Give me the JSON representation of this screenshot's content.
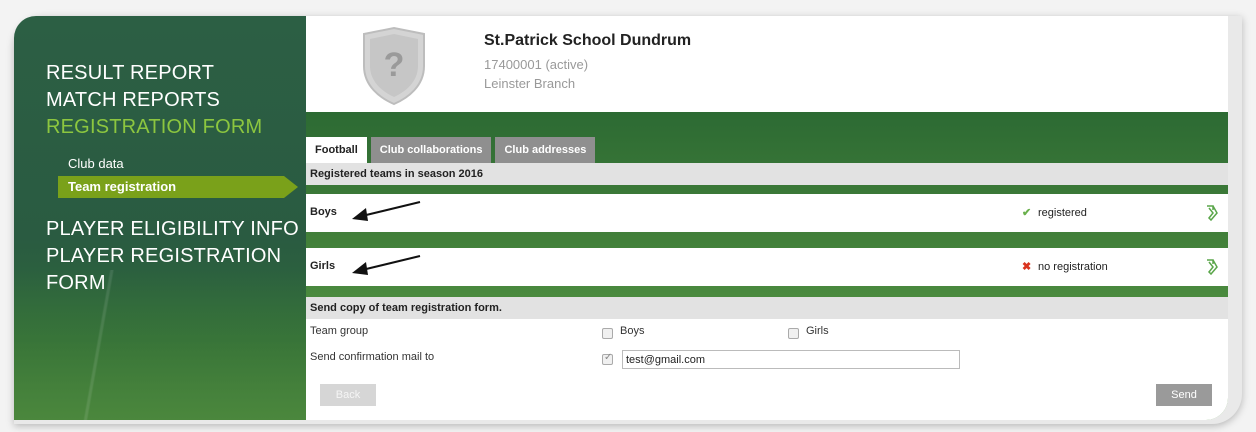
{
  "sidebar": {
    "nav_top": [
      "RESULT REPORT",
      "MATCH REPORTS",
      "REGISTRATION FORM"
    ],
    "sub_items": [
      "Club data",
      "Team registration"
    ],
    "nav_bottom": [
      "PLAYER ELIGIBILITY INFO",
      "PLAYER REGISTRATION FORM"
    ]
  },
  "club": {
    "name": "St.Patrick School Dundrum",
    "id_status": "17400001 (active)",
    "branch": "Leinster Branch"
  },
  "tabs": [
    "Football",
    "Club collaborations",
    "Club addresses"
  ],
  "teams_header": "Registered teams in season 2016",
  "teams": [
    {
      "label": "Boys",
      "status": "registered",
      "status_icon": "check-icon"
    },
    {
      "label": "Girls",
      "status": "no registration",
      "status_icon": "cross-icon"
    }
  ],
  "form": {
    "header": "Send copy of team registration form.",
    "team_group_label": "Team group",
    "options": [
      "Boys",
      "Girls"
    ],
    "mail_label": "Send confirmation mail to",
    "mail_value": "test@gmail.com",
    "back_label": "Back",
    "send_label": "Send"
  },
  "colors": {
    "sidebar": "#2a5b41",
    "accent": "#8cc63f",
    "active_sub": "#7aa11a"
  }
}
